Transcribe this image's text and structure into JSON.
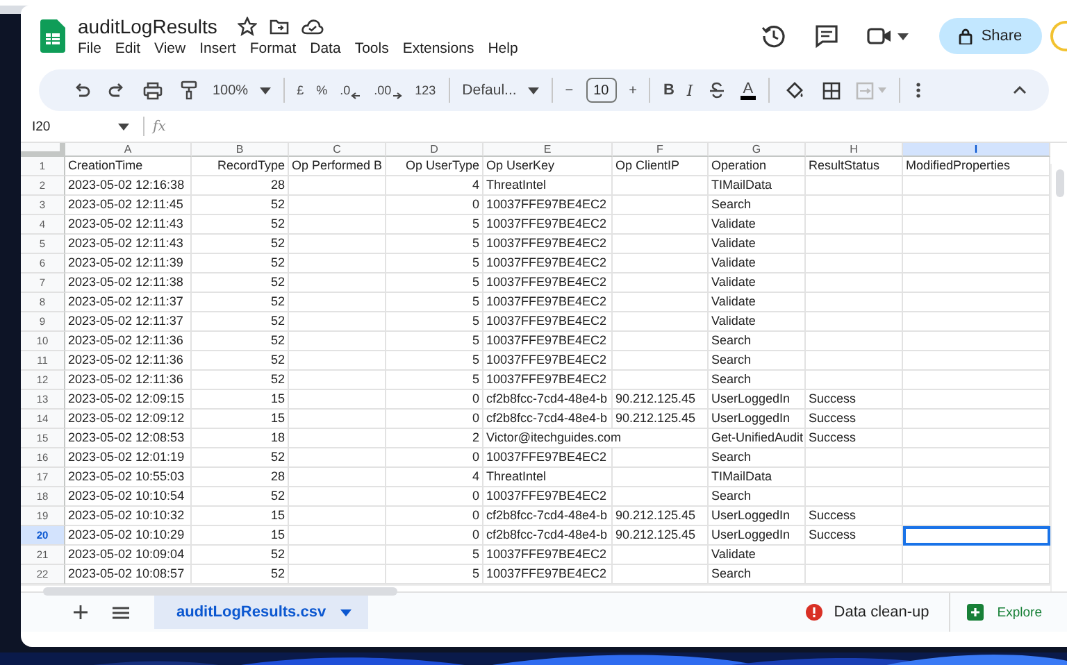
{
  "document": {
    "title": "auditLogResults"
  },
  "menu": [
    "File",
    "Edit",
    "View",
    "Insert",
    "Format",
    "Data",
    "Tools",
    "Extensions",
    "Help"
  ],
  "share_button": {
    "label": "Share"
  },
  "toolbar": {
    "zoom": "100%",
    "format_items": [
      {
        "label": "£",
        "kind": "plain"
      },
      {
        "label": "%",
        "kind": "plain"
      },
      {
        "label": ".0",
        "kind": "arrow-left"
      },
      {
        "label": ".00",
        "kind": "arrow-right"
      },
      {
        "label": "123",
        "kind": "plain"
      }
    ],
    "font": "Defaul...",
    "decrease": "−",
    "font_size": "10",
    "increase": "+",
    "bold": "B",
    "italic": "I",
    "text_color": "A"
  },
  "formula_bar": {
    "cell_ref": "I20",
    "fx": "fx"
  },
  "columns": [
    {
      "label": "A",
      "kind": "text",
      "selected": false
    },
    {
      "label": "B",
      "kind": "number",
      "selected": false
    },
    {
      "label": "C",
      "kind": "text",
      "selected": false
    },
    {
      "label": "D",
      "kind": "number",
      "selected": false
    },
    {
      "label": "E",
      "kind": "text",
      "selected": false
    },
    {
      "label": "F",
      "kind": "text",
      "selected": false
    },
    {
      "label": "G",
      "kind": "text",
      "selected": false
    },
    {
      "label": "H",
      "kind": "text",
      "selected": false
    },
    {
      "label": "I",
      "kind": "text",
      "selected": true
    }
  ],
  "rows": [
    {
      "number": "1",
      "selected": false,
      "cells": [
        "CreationTime",
        "RecordType",
        "Op Performed B",
        "Op UserType",
        "Op UserKey",
        "Op ClientIP",
        "Operation",
        "ResultStatus",
        "ModifiedProperties"
      ]
    },
    {
      "number": "2",
      "selected": false,
      "cells": [
        "2023-05-02 12:16:38",
        "28",
        null,
        "4",
        "ThreatIntel",
        null,
        "TIMailData",
        null,
        null
      ]
    },
    {
      "number": "3",
      "selected": false,
      "cells": [
        "2023-05-02 12:11:45",
        "52",
        null,
        "0",
        "10037FFE97BE4EC2",
        null,
        "Search",
        null,
        null
      ]
    },
    {
      "number": "4",
      "selected": false,
      "cells": [
        "2023-05-02 12:11:43",
        "52",
        null,
        "5",
        "10037FFE97BE4EC2",
        null,
        "Validate",
        null,
        null
      ]
    },
    {
      "number": "5",
      "selected": false,
      "cells": [
        "2023-05-02 12:11:43",
        "52",
        null,
        "5",
        "10037FFE97BE4EC2",
        null,
        "Validate",
        null,
        null
      ]
    },
    {
      "number": "6",
      "selected": false,
      "cells": [
        "2023-05-02 12:11:39",
        "52",
        null,
        "5",
        "10037FFE97BE4EC2",
        null,
        "Validate",
        null,
        null
      ]
    },
    {
      "number": "7",
      "selected": false,
      "cells": [
        "2023-05-02 12:11:38",
        "52",
        null,
        "5",
        "10037FFE97BE4EC2",
        null,
        "Validate",
        null,
        null
      ]
    },
    {
      "number": "8",
      "selected": false,
      "cells": [
        "2023-05-02 12:11:37",
        "52",
        null,
        "5",
        "10037FFE97BE4EC2",
        null,
        "Validate",
        null,
        null
      ]
    },
    {
      "number": "9",
      "selected": false,
      "cells": [
        "2023-05-02 12:11:37",
        "52",
        null,
        "5",
        "10037FFE97BE4EC2",
        null,
        "Validate",
        null,
        null
      ]
    },
    {
      "number": "10",
      "selected": false,
      "cells": [
        "2023-05-02 12:11:36",
        "52",
        null,
        "5",
        "10037FFE97BE4EC2",
        null,
        "Search",
        null,
        null
      ]
    },
    {
      "number": "11",
      "selected": false,
      "cells": [
        "2023-05-02 12:11:36",
        "52",
        null,
        "5",
        "10037FFE97BE4EC2",
        null,
        "Search",
        null,
        null
      ]
    },
    {
      "number": "12",
      "selected": false,
      "cells": [
        "2023-05-02 12:11:36",
        "52",
        null,
        "5",
        "10037FFE97BE4EC2",
        null,
        "Search",
        null,
        null
      ]
    },
    {
      "number": "13",
      "selected": false,
      "cells": [
        "2023-05-02 12:09:15",
        "15",
        null,
        "0",
        "cf2b8fcc-7cd4-48e4-b",
        "90.212.125.45",
        "UserLoggedIn",
        "Success",
        null
      ]
    },
    {
      "number": "14",
      "selected": false,
      "cells": [
        "2023-05-02 12:09:12",
        "15",
        null,
        "0",
        "cf2b8fcc-7cd4-48e4-b",
        "90.212.125.45",
        "UserLoggedIn",
        "Success",
        null
      ]
    },
    {
      "number": "15",
      "selected": false,
      "cells": [
        "2023-05-02 12:08:53",
        "18",
        null,
        "2",
        "Victor@itechguides.com",
        null,
        "Get-UnifiedAudit",
        "Success",
        null
      ]
    },
    {
      "number": "16",
      "selected": false,
      "cells": [
        "2023-05-02 12:01:19",
        "52",
        null,
        "0",
        "10037FFE97BE4EC2",
        null,
        "Search",
        null,
        null
      ]
    },
    {
      "number": "17",
      "selected": false,
      "cells": [
        "2023-05-02 10:55:03",
        "28",
        null,
        "4",
        "ThreatIntel",
        null,
        "TIMailData",
        null,
        null
      ]
    },
    {
      "number": "18",
      "selected": false,
      "cells": [
        "2023-05-02 10:10:54",
        "52",
        null,
        "0",
        "10037FFE97BE4EC2",
        null,
        "Search",
        null,
        null
      ]
    },
    {
      "number": "19",
      "selected": false,
      "cells": [
        "2023-05-02 10:10:32",
        "15",
        null,
        "0",
        "cf2b8fcc-7cd4-48e4-b",
        "90.212.125.45",
        "UserLoggedIn",
        "Success",
        null
      ]
    },
    {
      "number": "20",
      "selected": true,
      "cells": [
        "2023-05-02 10:10:29",
        "15",
        null,
        "0",
        "cf2b8fcc-7cd4-48e4-b",
        "90.212.125.45",
        "UserLoggedIn",
        "Success",
        null
      ]
    },
    {
      "number": "21",
      "selected": false,
      "cells": [
        "2023-05-02 10:09:04",
        "52",
        null,
        "5",
        "10037FFE97BE4EC2",
        null,
        "Validate",
        null,
        null
      ]
    },
    {
      "number": "22",
      "selected": false,
      "cells": [
        "2023-05-02 10:08:57",
        "52",
        null,
        "5",
        "10037FFE97BE4EC2",
        null,
        "Search",
        null,
        null
      ]
    }
  ],
  "sheet_tabs": [
    {
      "label": "auditLogResults.csv",
      "selected": true
    }
  ],
  "data_cleanup": {
    "label": "Data clean-up"
  },
  "explore": {
    "label": "Explore"
  }
}
